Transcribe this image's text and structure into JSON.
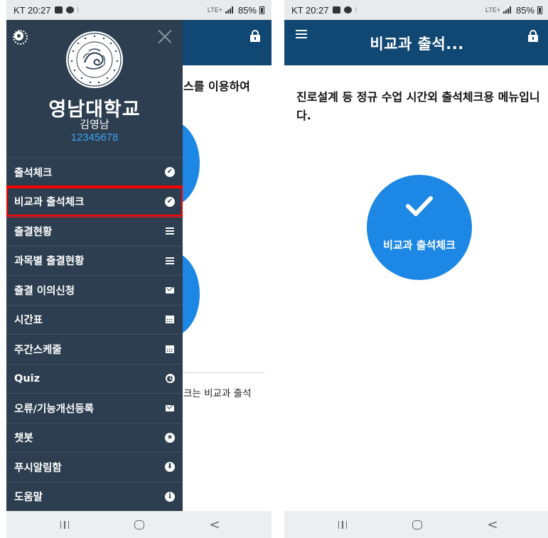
{
  "status_bar": {
    "time_label": "KT 20:27",
    "network_label": "LTE+",
    "battery_label": "85%"
  },
  "left": {
    "drawer": {
      "university_name": "영남대학교",
      "user_name": "김영남",
      "user_id": "12345678",
      "seal_text": "YEUNGNAM UNIVERSITY 1947",
      "items": [
        {
          "label": "출석체크",
          "icon": "check-circle-icon"
        },
        {
          "label": "비교과 출석체크",
          "icon": "check-circle-icon"
        },
        {
          "label": "출결현황",
          "icon": "list-icon"
        },
        {
          "label": "과목별 출결현황",
          "icon": "list-icon"
        },
        {
          "label": "출결 이의신청",
          "icon": "envelope-icon"
        },
        {
          "label": "시간표",
          "icon": "calendar-icon"
        },
        {
          "label": "주간스케줄",
          "icon": "calendar-icon"
        },
        {
          "label": "Quiz",
          "icon": "clock-icon"
        },
        {
          "label": "오류/기능개선등록",
          "icon": "envelope-icon"
        },
        {
          "label": "챗봇",
          "icon": "star-icon"
        },
        {
          "label": "푸시알림함",
          "icon": "arrow-down-icon"
        },
        {
          "label": "도움말",
          "icon": "info-icon"
        }
      ],
      "highlighted_item": "비교과 출석체크"
    },
    "background": {
      "line1": "스를 이용하여",
      "line2": "크는 비교과 출석"
    }
  },
  "right": {
    "header_title": "비교과 출석...",
    "description": "진로설계 등 정규 수업 시간외 출석체크용 메뉴입니다.",
    "button_label": "비교과 출석체크"
  },
  "colors": {
    "header": "#104773",
    "drawer": "#2c3e4f",
    "accent": "#1c87e4",
    "user_id": "#3ba2f0",
    "highlight": "#ff0000"
  }
}
